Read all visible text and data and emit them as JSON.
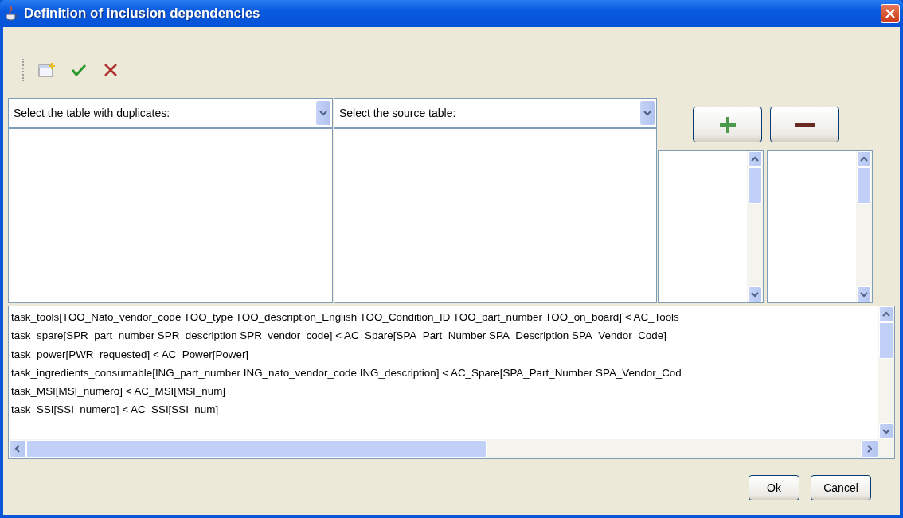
{
  "window": {
    "title": "Definition of inclusion dependencies"
  },
  "toolbar": [
    {
      "kind": "new"
    },
    {
      "kind": "accept"
    },
    {
      "kind": "reject"
    }
  ],
  "combos": [
    {
      "label": "Select the table with duplicates:"
    },
    {
      "label": "Select the source table:"
    }
  ],
  "list_buttons": [
    {
      "kind": "add"
    },
    {
      "kind": "remove"
    }
  ],
  "dependencies": [
    "task_tools[TOO_Nato_vendor_code TOO_type TOO_description_English TOO_Condition_ID TOO_part_number TOO_on_board] < AC_Tools",
    "task_spare[SPR_part_number SPR_description SPR_vendor_code] < AC_Spare[SPA_Part_Number SPA_Description SPA_Vendor_Code]",
    "task_power[PWR_requested] < AC_Power[Power]",
    "task_ingredients_consumable[ING_part_number ING_nato_vendor_code ING_description] < AC_Spare[SPA_Part_Number SPA_Vendor_Cod",
    "task_MSI[MSI_numero] < AC_MSI[MSI_num]",
    "task_SSI[SSI_numero] < AC_SSI[SSI_num]"
  ],
  "buttons": [
    "Ok",
    "Cancel"
  ]
}
